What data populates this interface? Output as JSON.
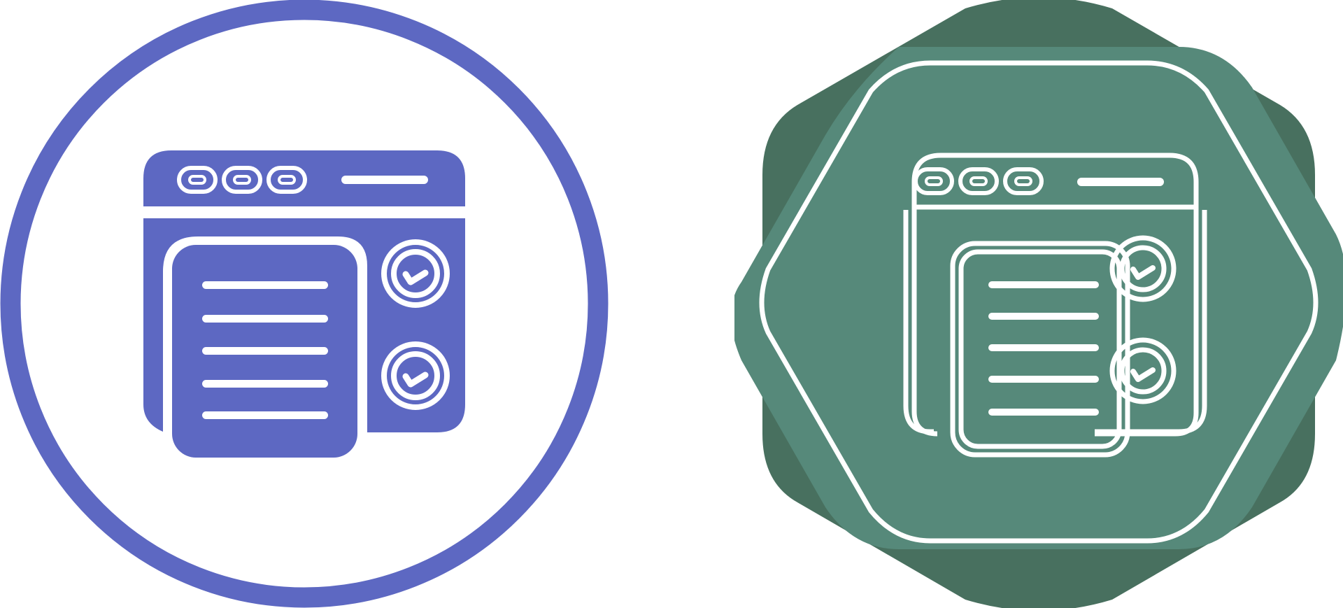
{
  "icons": [
    {
      "name": "web-task-list",
      "style": "glyph",
      "badge_shape": "circle",
      "colors": {
        "primary": "#5d68c2",
        "background": "#ffffff"
      },
      "window_dots": 3,
      "list_lines": 5,
      "check_circles": 2
    },
    {
      "name": "web-task-list",
      "style": "line",
      "badge_shape": "rounded-octagon-star",
      "colors": {
        "badge_shadow": "#48705f",
        "badge_fill": "#56897a",
        "line": "#ffffff"
      },
      "window_dots": 3,
      "list_lines": 5,
      "check_circles": 2
    }
  ]
}
